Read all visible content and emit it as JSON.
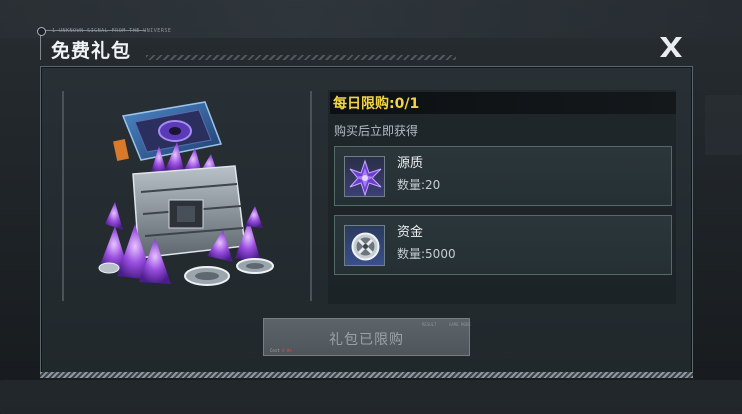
{
  "header": {
    "caption": "1 UNKNOWN SIGNAL FROM THE UNIVERSE",
    "title": "免费礼包"
  },
  "close_icon": "close-x-icon",
  "pack": {
    "image": "crystal-chest-icon",
    "limit_text": "每日限购:0/1",
    "subtitle": "购买后立即获得",
    "rewards": [
      {
        "icon": "crystal-shard-icon",
        "name": "源质",
        "qty_label": "数量:",
        "qty": "20"
      },
      {
        "icon": "gear-coin-icon",
        "name": "资金",
        "qty_label": "数量:",
        "qty": "5000"
      }
    ]
  },
  "claim_button": {
    "label": "礼包已限购",
    "tiny_a": "RESULT",
    "tiny_b": "GAME MODE",
    "tiny_c_prefix": "Cost ",
    "tiny_c_value": "0 0%"
  },
  "colors": {
    "limit_text": "#f2d447",
    "panel": "#262d31",
    "card_border": "#536a66"
  }
}
